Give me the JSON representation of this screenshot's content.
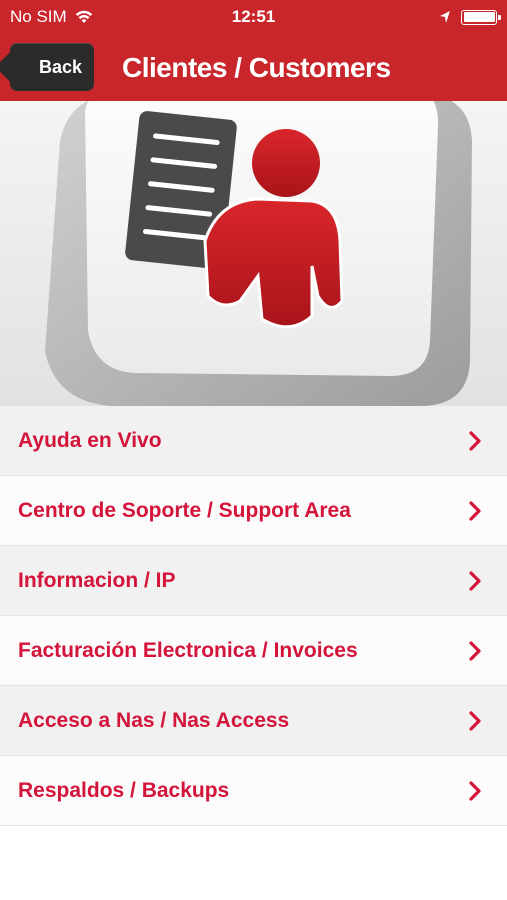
{
  "status_bar": {
    "carrier": "No SIM",
    "time": "12:51"
  },
  "nav": {
    "back_label": "Back",
    "title": "Clientes / Customers"
  },
  "colors": {
    "accent": "#c9262c",
    "menu_text": "#d4143a",
    "back_button": "#2b2b2b"
  },
  "hero": {
    "icon": "customer-list-key-icon"
  },
  "menu": {
    "items": [
      {
        "label": "Ayuda en Vivo",
        "icon": "chevron-right-icon"
      },
      {
        "label": "Centro de Soporte / Support Area",
        "icon": "chevron-right-icon"
      },
      {
        "label": "Informacion / IP",
        "icon": "chevron-right-icon"
      },
      {
        "label": "Facturación Electronica / Invoices",
        "icon": "chevron-right-icon"
      },
      {
        "label": "Acceso a Nas / Nas Access",
        "icon": "chevron-right-icon"
      },
      {
        "label": "Respaldos / Backups",
        "icon": "chevron-right-icon"
      }
    ]
  }
}
